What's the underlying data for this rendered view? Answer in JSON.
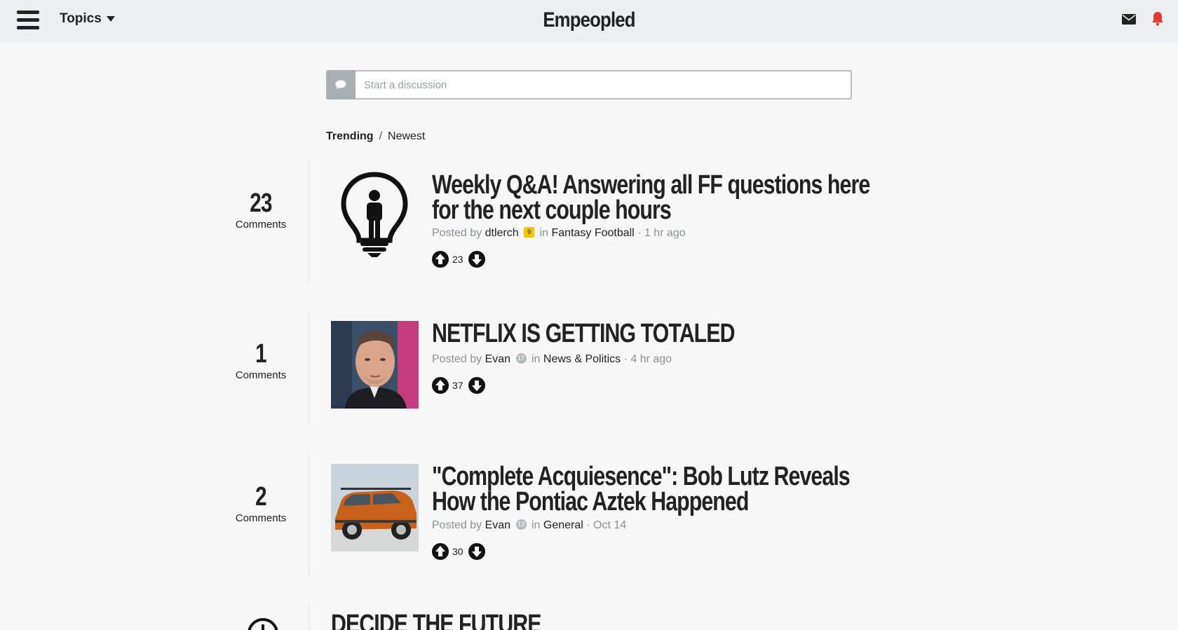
{
  "header": {
    "menu_icon": "hamburger-icon",
    "topics_label": "Topics",
    "brand": "Empeopled",
    "mail_icon": "envelope-icon",
    "bell_icon": "bell-icon",
    "bell_color": "#e53935"
  },
  "composer": {
    "icon": "speech-bubble-icon",
    "placeholder": "Start a discussion"
  },
  "sort": {
    "active": "Trending",
    "separator": "/",
    "other": "Newest"
  },
  "posts": [
    {
      "comments": "23",
      "comments_label": "Comments",
      "thumbnail": "lightbulb-person-icon",
      "title": "Weekly Q&A! Answering all FF questions here for the next couple hours",
      "posted_by": "Posted by",
      "author": "dtlerch",
      "author_badge": "9",
      "in": "in",
      "topic": "Fantasy Football",
      "time": "· 1 hr ago",
      "score": "23"
    },
    {
      "comments": "1",
      "comments_label": "Comments",
      "thumbnail": "man-portrait-photo",
      "title": "NETFLIX IS GETTING TOTALED",
      "posted_by": "Posted by",
      "author": "Evan",
      "author_badge": "17",
      "in": "in",
      "topic": "News & Politics",
      "time": "· 4 hr ago",
      "score": "37"
    },
    {
      "comments": "2",
      "comments_label": "Comments",
      "thumbnail": "orange-suv-photo",
      "title": "\"Complete Acquiesence\": Bob Lutz Reveals How the Pontiac Aztek Happened",
      "posted_by": "Posted by",
      "author": "Evan",
      "author_badge": "13",
      "in": "in",
      "topic": "General",
      "time": "· Oct 14",
      "score": "30"
    },
    {
      "title": "DECIDE THE FUTURE"
    }
  ]
}
